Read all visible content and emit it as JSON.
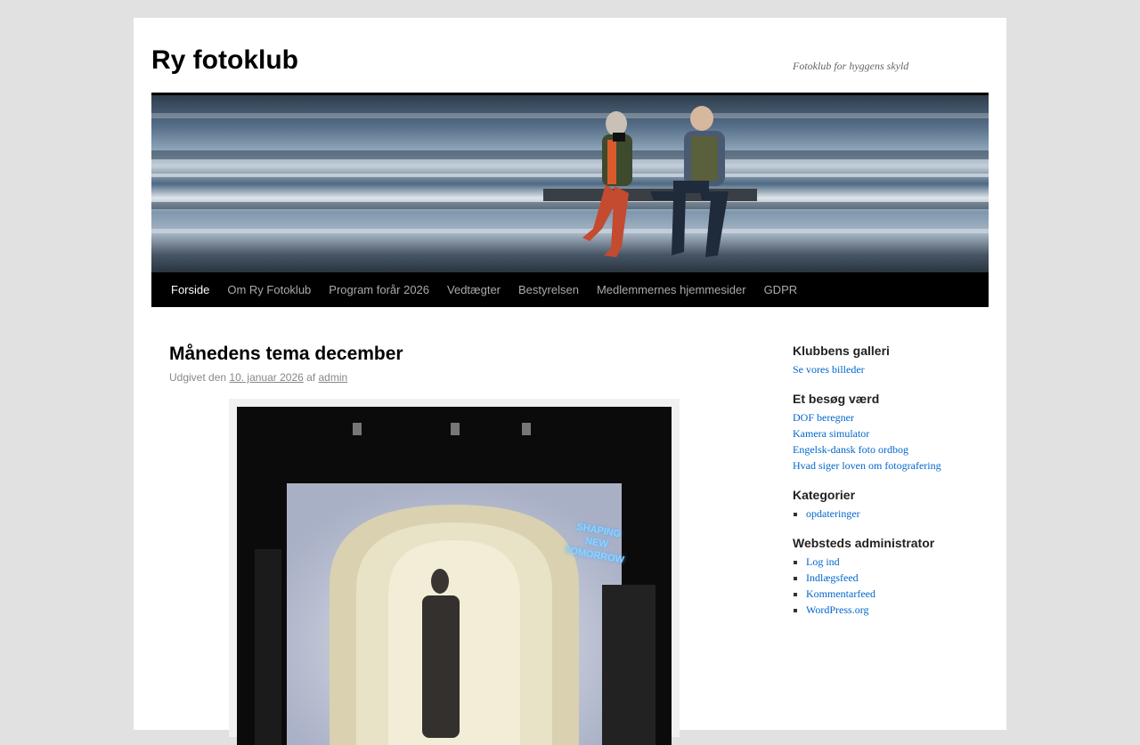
{
  "site": {
    "title": "Ry fotoklub",
    "description": "Fotoklub for hyggens skyld"
  },
  "nav": [
    {
      "label": "Forside",
      "current": true
    },
    {
      "label": "Om Ry Fotoklub"
    },
    {
      "label": "Program forår 2026"
    },
    {
      "label": "Vedtægter"
    },
    {
      "label": "Bestyrelsen"
    },
    {
      "label": "Medlemmernes hjemmesider"
    },
    {
      "label": "GDPR"
    }
  ],
  "post": {
    "title": "Månedens tema december",
    "meta_prefix": "Udgivet den",
    "date": "10. januar 2026",
    "meta_by": "af",
    "author": "admin",
    "photo_sign": [
      "SHAPING",
      "NEW",
      "TOMORROW"
    ]
  },
  "sidebar": {
    "gallery": {
      "title": "Klubbens galleri",
      "link": "Se vores billeder"
    },
    "visit": {
      "title": "Et besøg værd",
      "links": [
        "DOF beregner",
        "Kamera simulator",
        "Engelsk-dansk foto ordbog",
        "Hvad siger loven om fotografering"
      ]
    },
    "categories": {
      "title": "Kategorier",
      "items": [
        "opdateringer"
      ]
    },
    "admin": {
      "title": "Websteds administrator",
      "items": [
        "Log ind",
        "Indlægsfeed",
        "Kommentarfeed",
        "WordPress.org"
      ]
    }
  },
  "colors": {
    "link": "#0066cc",
    "nav_bg": "#000000",
    "page_bg": "#e1e1e1"
  }
}
